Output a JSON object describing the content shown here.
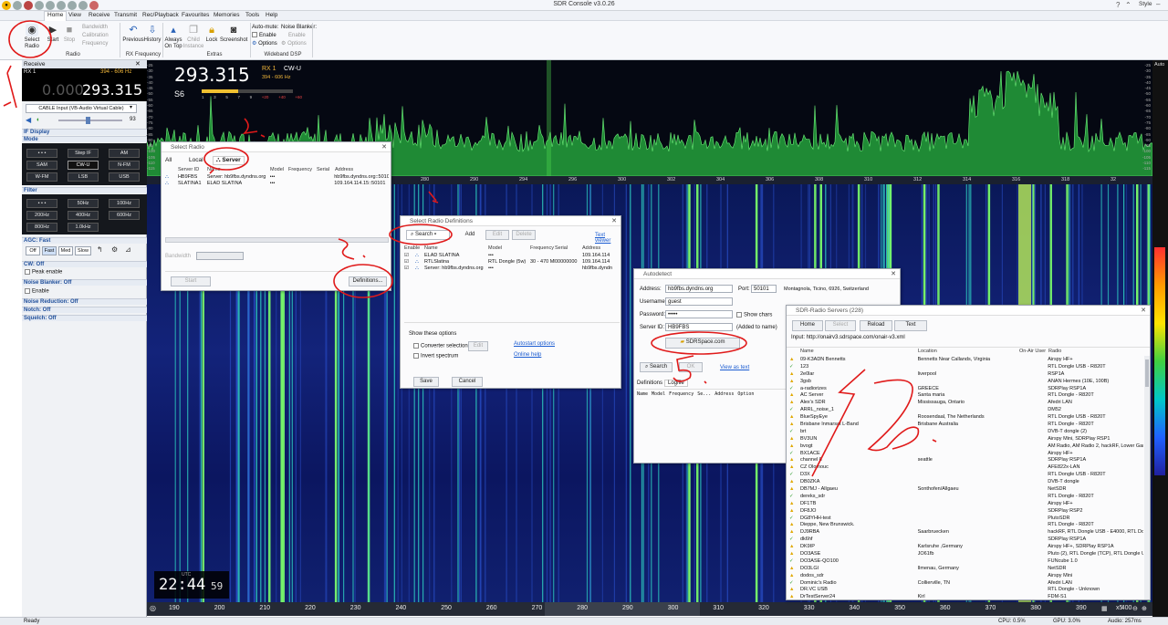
{
  "window": {
    "title": "SDR Console v3.0.26",
    "style": "Style"
  },
  "menu": [
    "Home",
    "View",
    "Receive",
    "Transmit",
    "Rec/Playback",
    "Favourites",
    "Memories",
    "Tools",
    "Help"
  ],
  "ribbon": {
    "select_radio": "Select Radio",
    "start": "Start",
    "stop": "Stop",
    "bandwidth": "Bandwidth",
    "calibration": "Calibration",
    "frequency": "Frequency",
    "previous": "Previous",
    "history": "History",
    "always": "Always",
    "on_top": "On Top",
    "child": "Child",
    "instance": "Instance",
    "lock": "Lock",
    "screenshot": "Screenshot",
    "auto_mute": "Auto-mute:",
    "enable": "Enable",
    "options": "Options",
    "noise_blanker": "Noise Blanker:",
    "nb_enable": "Enable",
    "nb_options": "Options",
    "groups": [
      "Radio",
      "RX Frequency",
      "Extras",
      "Wideband DSP"
    ]
  },
  "left": {
    "receive": "Receive",
    "rx": "RX 1",
    "rx_range": "394 - 606 Hz",
    "freq_dim": "0.000.",
    "freq": "293.315",
    "input": "CABLE Input (VB-Audio Virtual Cable)",
    "volume": "93",
    "if_display": "IF Display",
    "mode": "Mode",
    "modes": [
      "• • •",
      "Step IF",
      "AM",
      "SAM",
      "CW-U",
      "N-FM",
      "W-FM",
      "LSB",
      "USB"
    ],
    "filter": "Filter",
    "filters": [
      "• • •",
      "50Hz",
      "100Hz",
      "200Hz",
      "400Hz",
      "600Hz",
      "800Hz",
      "1.0kHz"
    ],
    "agc": "AGC: Fast",
    "agc_btns": [
      "Off",
      "Fast",
      "Med",
      "Slow"
    ],
    "cw": "CW: Off",
    "peak": "Peak enable",
    "nb": "Noise Blanker: Off",
    "nb_enable": "Enable",
    "nr": "Noise Reduction: Off",
    "notch": "Notch: Off",
    "squelch": "Squelch: Off"
  },
  "display": {
    "freq": "293.315",
    "rx": "RX 1",
    "mode": "CW-U",
    "range": "394 - 606 Hz",
    "s": "S6",
    "smeter_scale": [
      "1",
      "3",
      "5",
      "7",
      "9",
      "+20",
      "+40",
      "+60"
    ],
    "db_scale": [
      "-25",
      "-30",
      "-35",
      "-40",
      "-45",
      "-50",
      "-55",
      "-60",
      "-65",
      "-70",
      "-75",
      "-80",
      "-85",
      "-90",
      "-95",
      "-100",
      "-105",
      "-110",
      "-115"
    ],
    "ruler_top": [
      "280",
      "290",
      "294",
      "296",
      "300",
      "302",
      "304",
      "306",
      "308",
      "310",
      "312",
      "314",
      "316",
      "318",
      "32"
    ],
    "ruler_bot": [
      "190",
      "200",
      "210",
      "220",
      "230",
      "240",
      "250",
      "260",
      "270",
      "280",
      "290",
      "300",
      "310",
      "320",
      "330",
      "340",
      "350",
      "360",
      "370",
      "380",
      "390",
      "400"
    ],
    "clock": "22:44",
    "clock_sec": "59",
    "clock_label": "UTC",
    "zoom": "x5",
    "auto": "Auto"
  },
  "select_radio": {
    "title": "Select Radio",
    "tabs": [
      "All",
      "Local",
      "Server"
    ],
    "cols": [
      "Server ID",
      "Name",
      "Model",
      "Frequency",
      "Serial",
      "Address"
    ],
    "rows": [
      [
        "HB9FBS",
        "Server: hb9fbs.dyndns.org",
        "•••",
        "",
        "",
        "hb9fbs.dyndns.org::5010"
      ],
      [
        "SLATINA1",
        "ELAD SLATINA",
        "•••",
        "",
        "",
        "109.164.114.15::50101"
      ]
    ],
    "bandwidth": "Bandwidth",
    "start": "Start",
    "definitions": "Definitions..."
  },
  "definitions": {
    "title": "Select Radio Definitions",
    "search": "Search",
    "add": "Add",
    "edit": "Edit",
    "delete": "Delete",
    "text_viewer": "Text viewer",
    "cols": [
      "Enable",
      "Name",
      "Model",
      "Frequency",
      "Serial",
      "Address"
    ],
    "rows": [
      [
        "ELAD SLATINA",
        "•••",
        "",
        "",
        "109.164.114"
      ],
      [
        "RTLSlatina",
        "RTL Dongle (5w)",
        "30 - 470 MHz",
        "00000000",
        "109.164.114"
      ],
      [
        "Server: hb9fbs.dyndns.org",
        "•••",
        "",
        "",
        "hb9fbs.dyndn"
      ]
    ],
    "show_options": "Show these options",
    "converter": "Converter selection",
    "edit_btn": "Edit",
    "invert": "Invert spectrum",
    "autostart": "Autostart options",
    "online_help": "Online help",
    "save": "Save",
    "cancel": "Cancel"
  },
  "autodetect": {
    "title": "Autodetect",
    "address_l": "Address:",
    "address": "hb9fbs.dyndns.org",
    "port_l": "Port:",
    "port": "50101",
    "location": "Montagnola, Ticino, 6926, Switzerland",
    "username_l": "Username:",
    "username": "guest",
    "password_l": "Password:",
    "password": "•••••",
    "show_chars": "Show chars",
    "serverid_l": "Server ID:",
    "serverid": "HB9FBS",
    "added": "(Added to name)",
    "sdrspace": "SDRSpace.com",
    "search": "Search",
    "ok": "OK",
    "view": "View as text",
    "tabs": [
      "Definitions",
      "Logfile"
    ],
    "cols": [
      "Name",
      "Model",
      "Frequency",
      "Se...",
      "Address",
      "Option"
    ]
  },
  "servers": {
    "title": "SDR-Radio Servers (228)",
    "home": "Home",
    "select": "Select",
    "reload": "Reload",
    "text": "Text",
    "input": "Input: http://onairv3.sdrspace.com/onair-v3.xml",
    "cols": [
      "Name",
      "Location",
      "On-Air User",
      "Radio"
    ],
    "rows": [
      [
        "09-K3ADN Bennetts",
        "Bennetts Near Callands, Virginia",
        "Airspy HF+"
      ],
      [
        "123",
        "",
        "RTL Dongle USB - R820T"
      ],
      [
        "2e0lar",
        "liverpool",
        "RSP1A"
      ],
      [
        "3gsb",
        "",
        "ANAN Hermes (10E, 100B)"
      ],
      [
        "a-radiorizes",
        "GREECE",
        "SDRPlay RSP1A"
      ],
      [
        "AC Server",
        "Santa maria",
        "RTL Dongle - R820T"
      ],
      [
        "Alex's SDR",
        "Mississauga, Ontario",
        "Afedri LAN"
      ],
      [
        "ARRL_noise_1",
        "",
        "DM52"
      ],
      [
        "BlueSpyEye",
        "Roosendaal, The Netherlands",
        "RTL Dongle USB - R820T"
      ],
      [
        "Brisbane Inmarsat L-Band",
        "Brisbane Australia",
        "RTL Dongle - R820T"
      ],
      [
        "brt",
        "",
        "DVB-T dongle (2)"
      ],
      [
        "BV3UN",
        "",
        "Airspy Mini, SDRPlay RSP1"
      ],
      [
        "bvogt",
        "",
        "AM Radio, AM Radio 2, hackRF, Lower Garag"
      ],
      [
        "BX1ACE",
        "",
        "Airspy HF+"
      ],
      [
        "channel 8",
        "seattle",
        "SDRPlay RSP1A"
      ],
      [
        "CZ Olomouc",
        "",
        "AFE822x-LAN"
      ],
      [
        "D3X",
        "",
        "RTL Dongle USB - R820T"
      ],
      [
        "DB0ZKA",
        "",
        "DVB-T dongle"
      ],
      [
        "DB7MJ - Allgaeu",
        "Sonthofen/Allgaeu",
        "NetSDR"
      ],
      [
        "dereks_sdr",
        "",
        "RTL Dongle - R820T"
      ],
      [
        "DF1TB",
        "",
        "Airspy HF+"
      ],
      [
        "DF8JO",
        "",
        "SDRPlay RSP2"
      ],
      [
        "DG8YHH-test",
        "",
        "PlutoSDR"
      ],
      [
        "Dieppe, New Brunswick.",
        "",
        "RTL Dongle - R820T"
      ],
      [
        "DJ9RBA",
        "Saarbruecken",
        "hackRF, RTL Dongle USB - E4000, RTL Dongle"
      ],
      [
        "dk6hf",
        "",
        "SDRPlay RSP1A"
      ],
      [
        "DK9IP",
        "Karlsruhe ,Germany",
        "Airspy HF+, SDRPlay RSP1A"
      ],
      [
        "DO3ASE",
        "JO61fb",
        "Pluto (2), RTL Dongle (TCP), RTL Dongle USB"
      ],
      [
        "DO3ASE-QO100",
        "",
        "FUNcube 1.0"
      ],
      [
        "DO3LGI",
        "Ilmenau, Germany",
        "NetSDR"
      ],
      [
        "dodos_sdr",
        "",
        "Airspy Mini"
      ],
      [
        "Dominic's Radio",
        "Collierville, TN",
        "Afedri LAN"
      ],
      [
        "DR.VC USB",
        "",
        "RTL Dongle - Unknown"
      ],
      [
        "DrTestServer24",
        "Kirl",
        "FDM-S1"
      ]
    ]
  },
  "statusbar": {
    "ready": "Ready",
    "cpu": "CPU: 0.5%",
    "gpu": "GPU: 3.0%",
    "audio": "Audio: 257ms"
  },
  "colors": {
    "spectrum_green": "#2fd34a",
    "waterfall_blue": "#13237a",
    "annotation_red": "#e01a1a",
    "accent": "#1f4e9a"
  }
}
